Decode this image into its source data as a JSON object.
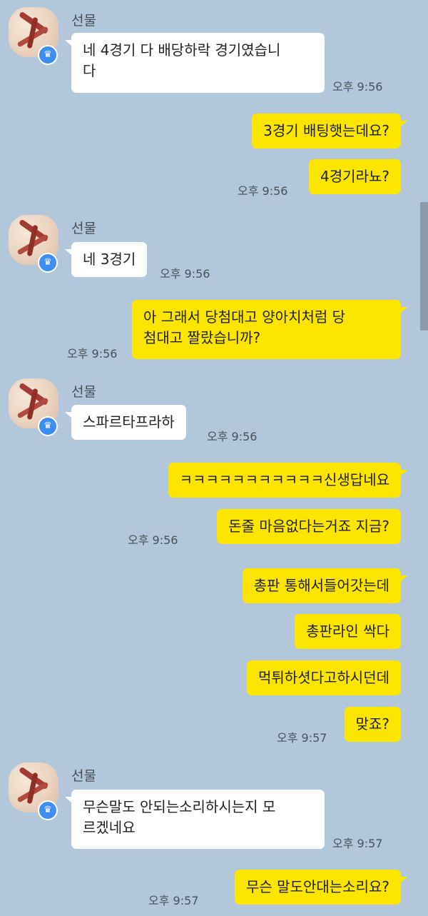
{
  "contact": {
    "name": "선물",
    "avatar_icon": "gift-ribbon-avatar",
    "badge_icon": "crown-icon"
  },
  "colors": {
    "background": "#b2c7da",
    "outgoing_bubble": "#fee500",
    "incoming_bubble": "#ffffff",
    "badge": "#3d8ef0"
  },
  "messages": {
    "m1": {
      "text": "네 4경기 다 배당하락 경기였습니\n다",
      "time": "오후 9:56"
    },
    "m2": {
      "text": "3경기 배팅햇는데요?"
    },
    "m3": {
      "text": "4경기라뇨?",
      "time": "오후 9:56"
    },
    "m4": {
      "text": "네 3경기",
      "time": "오후 9:56"
    },
    "m5": {
      "text": "아 그래서 당첨대고 양아치처럼 당\n첨대고 짤랐습니까?",
      "time": "오후 9:56"
    },
    "m6": {
      "text": "스파르타프라하",
      "time": "오후 9:56"
    },
    "m7": {
      "text": "ㅋㅋㅋㅋㅋㅋㅋㅋㅋㅋㅋ신생답네요"
    },
    "m8": {
      "text": "돈줄 마음없다는거죠 지금?",
      "time": "오후 9:56"
    },
    "m9": {
      "text": "총판 통해서들어갓는데"
    },
    "m10": {
      "text": "총판라인 싹다"
    },
    "m11": {
      "text": "먹튀하셧다고하시던데"
    },
    "m12": {
      "text": "맞죠?",
      "time": "오후 9:57"
    },
    "m13": {
      "text": "무슨말도 안되는소리하시는지 모\n르겠네요",
      "time": "오후 9:57"
    },
    "m14": {
      "text": "무슨 말도안대는소리요?",
      "time": "오후 9:57"
    }
  }
}
